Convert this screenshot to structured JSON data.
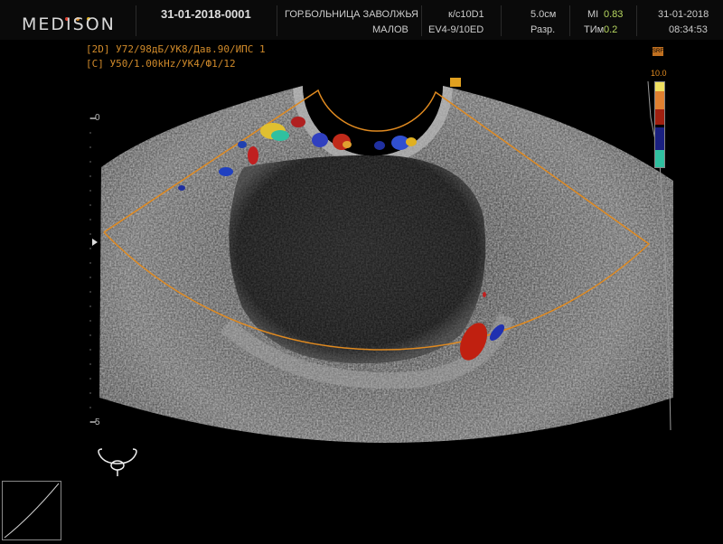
{
  "header": {
    "logo": "MEDISON",
    "logo_dot_colors": [
      "#e04030",
      "#e08a20",
      "#e0b020"
    ],
    "patient_id": "31-01-2018-0001",
    "hospital": "ГОР.БОЛЬНИЦА ЗАВОЛЖЬЯ",
    "operator": "МАЛОВ",
    "preset": "к/с10D1",
    "probe": "EV4-9/10ED",
    "depth": "5.0см",
    "resolution": "Разр.",
    "mi_label": "MI",
    "mi_value": "0.83",
    "tim_label": "ТИм",
    "tim_value": "0.2",
    "date": "31-01-2018",
    "time": "08:34:53"
  },
  "params": {
    "line_2d": "[2D] У72/98дБ/УК8/Дав.90/ИПС 1",
    "line_color": "[C] У50/1.00kHz/УК4/Ф1/12"
  },
  "scale": {
    "depth_top": "0",
    "depth_bottom": "5"
  },
  "color_bar": {
    "top_value": "10.0",
    "srf_label": "SRF"
  },
  "icons": [
    "uterus-icon",
    "gamma-curve-icon",
    "depth-marker-icon"
  ]
}
